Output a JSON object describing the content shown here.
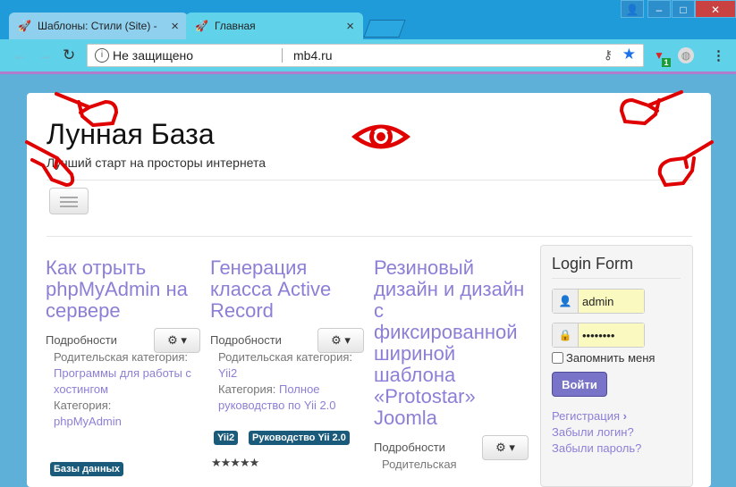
{
  "browser": {
    "tabs": [
      {
        "label": "Шаблоны: Стили (Site) - ",
        "close": "×"
      },
      {
        "label": "Главная",
        "close": "×"
      }
    ],
    "insecure_label": "Не защищено",
    "url": "mb4.ru",
    "extension_badge": "1"
  },
  "site": {
    "title": "Лунная База",
    "tagline": "Лучший старт на просторы интернета"
  },
  "articles": [
    {
      "title": "Как отрыть phpMyAdmin на сервере",
      "details": "Подробности",
      "parent_label": "Родительская категория:",
      "parent_link": "Программы для работы с хостингом",
      "category_label": "Категория:",
      "category_link": "phpMyAdmin",
      "tags": [
        "Базы данных"
      ]
    },
    {
      "title": "Генерация класса Active Record",
      "details": "Подробности",
      "parent_label": "Родительская категория:",
      "parent_link": "Yii2",
      "category_label": "Категория:",
      "category_link": "Полное руководство по Yii 2.0",
      "tags": [
        "Yii2",
        "Руководство Yii 2.0"
      ],
      "rating": "★★★★★"
    },
    {
      "title": "Резиновый дизайн и дизайн с фиксированной шириной шаблона «Protostar» Joomla",
      "details": "Подробности",
      "parent_label": "Родительская"
    }
  ],
  "login": {
    "title": "Login Form",
    "username": "admin",
    "password": "••••••••",
    "remember": "Запомнить меня",
    "button": "Войти",
    "register": "Регистрация",
    "forgot_login": "Забыли логин?",
    "forgot_password": "Забыли пароль?"
  },
  "colors": {
    "accent": "#8c7fd6",
    "tag_bg": "#1a5a7a",
    "overlay_red": "#e00000"
  }
}
